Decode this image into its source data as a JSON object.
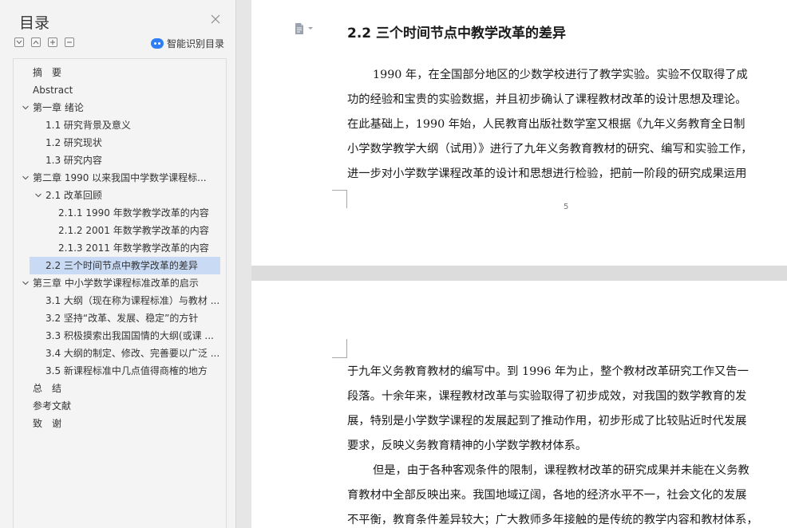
{
  "toc": {
    "title": "目录",
    "smart_label": "智能识别目录",
    "items": [
      {
        "label": "摘　要",
        "level": 1,
        "chevron": false,
        "selected": false
      },
      {
        "label": "Abstract",
        "level": 1,
        "chevron": false,
        "selected": false
      },
      {
        "label": "第一章 绪论",
        "level": 1,
        "chevron": true,
        "selected": false
      },
      {
        "label": "1.1 研究背景及意义",
        "level": 2,
        "chevron": false,
        "selected": false
      },
      {
        "label": "1.2 研究现状",
        "level": 2,
        "chevron": false,
        "selected": false
      },
      {
        "label": "1.3 研究内容",
        "level": 2,
        "chevron": false,
        "selected": false
      },
      {
        "label": "第二章 1990 以来我国中学数学课程标...",
        "level": 1,
        "chevron": true,
        "selected": false
      },
      {
        "label": "2.1 改革回顾",
        "level": 2,
        "chevron": true,
        "selected": false
      },
      {
        "label": "2.1.1 1990 年数学教学改革的内容",
        "level": 3,
        "chevron": false,
        "selected": false
      },
      {
        "label": "2.1.2 2001 年数学教学改革的内容",
        "level": 3,
        "chevron": false,
        "selected": false
      },
      {
        "label": "2.1.3 2011 年数学教学改革的内容",
        "level": 3,
        "chevron": false,
        "selected": false
      },
      {
        "label": "2.2 三个时间节点中教学改革的差异",
        "level": 2,
        "chevron": false,
        "selected": true
      },
      {
        "label": "第三章 中小学数学课程标准改革的启示",
        "level": 1,
        "chevron": true,
        "selected": false
      },
      {
        "label": "3.1 大纲（现在称为课程标准）与教材 ...",
        "level": 2,
        "chevron": false,
        "selected": false
      },
      {
        "label": "3.2 坚持“改革、发展、稳定”的方针",
        "level": 2,
        "chevron": false,
        "selected": false
      },
      {
        "label": "3.3 积极摸索出我国国情的大纲(或课 ...",
        "level": 2,
        "chevron": false,
        "selected": false
      },
      {
        "label": "3.4 大纲的制定、修改、完善要以广泛 ...",
        "level": 2,
        "chevron": false,
        "selected": false
      },
      {
        "label": "3.5 新课程标准中几点值得商榷的地方",
        "level": 2,
        "chevron": false,
        "selected": false
      },
      {
        "label": "总　结",
        "level": 1,
        "chevron": false,
        "selected": false
      },
      {
        "label": "参考文献",
        "level": 1,
        "chevron": false,
        "selected": false
      },
      {
        "label": "致　谢",
        "level": 1,
        "chevron": false,
        "selected": false
      }
    ]
  },
  "document": {
    "page1": {
      "heading": "2.2  三个时间节点中教学改革的差异",
      "lines": [
        {
          "text": "1990 年，在全国部分地区的少数学校进行了教学实验。实验不仅取得了成",
          "indent": true
        },
        {
          "text": "功的经验和宝贵的实验数据，并且初步确认了课程教材改革的设计思想及理论。",
          "indent": false
        },
        {
          "text": "在此基础上，1990 年始，人民教育出版社数学室又根据《九年义务教育全日制",
          "indent": false
        },
        {
          "text": "小学数学教学大纲（试用）》进行了九年义务教育教材的研究、编写和实验工作，",
          "indent": false
        },
        {
          "text": "进一步对小学数学课程改革的设计和思想进行检验，把前一阶段的研究成果运用",
          "indent": false
        }
      ],
      "page_number": "5"
    },
    "page2": {
      "lines": [
        {
          "text": "于九年义务教育教材的编写中。到 1996 年为止，整个教材改革研究工作又告一",
          "indent": false
        },
        {
          "text": "段落。十余年来，课程教材改革与实验取得了初步成效，对我国的数学教育的发",
          "indent": false
        },
        {
          "text": "展，特别是小学数学课程的发展起到了推动作用，初步形成了比较贴近时代发展",
          "indent": false
        },
        {
          "text": "要求，反映义务教育精神的小学数学教材体系。",
          "indent": false
        },
        {
          "text": "但是，由于各种客观条件的限制，课程教材改革的研究成果并未能在义务教",
          "indent": true
        },
        {
          "text": "育教材中全部反映出来。我国地域辽阔，各地的经济水平不一，社会文化的发展",
          "indent": false
        },
        {
          "text": "不平衡，教育条件差异较大；广大教师多年接触的是传统的教学内容和教材体系，",
          "indent": false
        }
      ]
    }
  },
  "colors": {
    "selection": "#c9daf4",
    "ai_icon": "#2f7ef5",
    "sidebar_bg": "#f3f3f3",
    "workspace_bg": "#e6e6e6"
  }
}
